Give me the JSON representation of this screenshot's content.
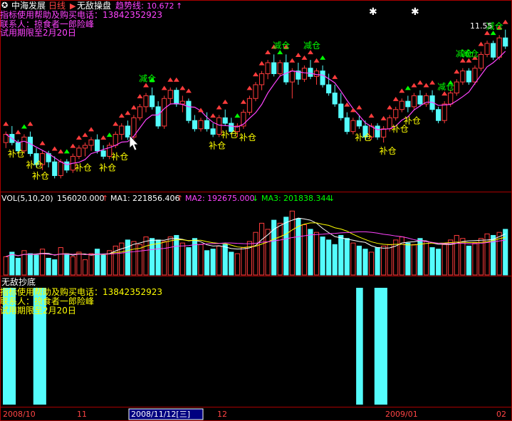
{
  "header": {
    "stock_name": "中海发展",
    "period": "日线",
    "indicator_name": "无敌操盘",
    "trend_label": "趋势线:",
    "trend_value": "10.672",
    "trend_arrow": "↑",
    "help_line": "指标使用帮助及购买电话：13842352923",
    "contact_line": "联系人：掠食者一郎险峰",
    "trial_line": "试用期限至2月20日",
    "price_callout": "11.55"
  },
  "volume_panel": {
    "label": "VOL(5,10,20)",
    "vol_value": "156020.000",
    "vol_arrow": "↑",
    "ma1_label": "MA1:",
    "ma1_value": "221856.406",
    "ma1_arrow": "↑",
    "ma2_label": "MA2:",
    "ma2_value": "192675.000",
    "ma2_arrow": "↓",
    "ma3_label": "MA3:",
    "ma3_value": "201838.344",
    "ma3_arrow": "↓"
  },
  "bottom_panel": {
    "title": "无敌抄底",
    "help_line": "指标使用帮助及购买电话：13842352923",
    "contact_line": "联系人：掠食者一郎险峰",
    "trial_line": "试用期限至2月20日"
  },
  "date_axis": {
    "label_1": "2008/10",
    "label_2": "11",
    "cursor_date": "2008/11/12[三]",
    "label_3": "12",
    "label_4": "2009/01",
    "label_5": "02"
  },
  "signals": {
    "reduce": "减仓",
    "add": "补仓"
  },
  "colors": {
    "up": "#ff3c3c",
    "down": "#54fcfc",
    "ma_trend": "#ff44ff",
    "ma1": "#ffffff",
    "ma2": "#ffff00",
    "ma3": "#ff44ff",
    "signal_green": "#00ff00",
    "signal_yellow": "#ffff00"
  },
  "chart_data": {
    "type": "candlestick",
    "candles": [
      [
        8.9,
        9.3,
        8.7,
        9.2
      ],
      [
        9.2,
        9.5,
        8.8,
        8.9
      ],
      [
        8.9,
        9.0,
        8.5,
        8.6
      ],
      [
        8.6,
        9.2,
        8.5,
        9.1
      ],
      [
        9.1,
        9.3,
        8.4,
        8.5
      ],
      [
        8.5,
        8.7,
        8.0,
        8.1
      ],
      [
        8.1,
        8.6,
        7.9,
        8.5
      ],
      [
        8.5,
        8.6,
        8.0,
        8.2
      ],
      [
        8.2,
        8.4,
        7.6,
        7.7
      ],
      [
        7.7,
        8.3,
        7.6,
        8.2
      ],
      [
        8.2,
        8.3,
        7.8,
        7.9
      ],
      [
        7.9,
        8.5,
        7.8,
        8.4
      ],
      [
        8.4,
        8.8,
        8.3,
        8.7
      ],
      [
        8.7,
        8.9,
        8.4,
        8.8
      ],
      [
        8.8,
        9.1,
        8.6,
        9.0
      ],
      [
        9.0,
        9.2,
        8.5,
        8.6
      ],
      [
        8.6,
        8.8,
        8.3,
        8.4
      ],
      [
        8.4,
        8.9,
        8.3,
        8.8
      ],
      [
        8.8,
        9.3,
        8.7,
        9.2
      ],
      [
        9.2,
        9.6,
        9.0,
        9.5
      ],
      [
        9.5,
        9.7,
        9.0,
        9.1
      ],
      [
        9.1,
        9.9,
        9.0,
        9.8
      ],
      [
        9.8,
        10.3,
        9.7,
        10.2
      ],
      [
        10.2,
        10.7,
        10.0,
        10.6
      ],
      [
        10.6,
        10.9,
        10.1,
        10.2
      ],
      [
        10.2,
        10.4,
        9.4,
        9.5
      ],
      [
        9.5,
        10.6,
        9.4,
        10.5
      ],
      [
        10.5,
        10.9,
        10.3,
        10.8
      ],
      [
        10.8,
        10.9,
        10.2,
        10.3
      ],
      [
        10.3,
        10.6,
        10.0,
        10.4
      ],
      [
        10.4,
        10.5,
        9.6,
        9.7
      ],
      [
        9.7,
        9.9,
        9.3,
        9.4
      ],
      [
        9.4,
        9.8,
        9.3,
        9.7
      ],
      [
        9.7,
        10.0,
        9.3,
        9.4
      ],
      [
        9.4,
        9.6,
        9.1,
        9.2
      ],
      [
        9.2,
        9.9,
        9.1,
        9.8
      ],
      [
        9.8,
        10.1,
        9.5,
        9.6
      ],
      [
        9.6,
        9.8,
        9.2,
        9.3
      ],
      [
        9.3,
        9.6,
        9.1,
        9.5
      ],
      [
        9.5,
        10.1,
        9.4,
        10.0
      ],
      [
        10.0,
        10.6,
        9.9,
        10.5
      ],
      [
        10.5,
        11.1,
        10.4,
        11.0
      ],
      [
        11.0,
        11.5,
        10.8,
        11.4
      ],
      [
        11.4,
        11.9,
        11.2,
        11.8
      ],
      [
        11.8,
        12.1,
        11.3,
        11.4
      ],
      [
        11.4,
        11.9,
        11.3,
        11.8
      ],
      [
        11.8,
        12.1,
        11.0,
        11.1
      ],
      [
        11.1,
        11.6,
        10.5,
        11.5
      ],
      [
        11.5,
        11.8,
        11.0,
        11.2
      ],
      [
        11.2,
        11.7,
        11.1,
        11.6
      ],
      [
        11.6,
        11.9,
        11.2,
        11.3
      ],
      [
        11.3,
        11.6,
        11.0,
        11.5
      ],
      [
        11.5,
        11.7,
        10.9,
        11.0
      ],
      [
        11.0,
        11.4,
        10.6,
        10.7
      ],
      [
        10.7,
        11.0,
        10.2,
        10.3
      ],
      [
        10.3,
        10.7,
        9.7,
        9.8
      ],
      [
        9.8,
        10.0,
        9.2,
        9.3
      ],
      [
        9.3,
        9.8,
        9.2,
        9.7
      ],
      [
        9.7,
        9.9,
        9.4,
        9.5
      ],
      [
        9.5,
        9.7,
        9.0,
        9.1
      ],
      [
        9.1,
        9.6,
        9.0,
        9.5
      ],
      [
        9.5,
        9.6,
        9.0,
        9.1
      ],
      [
        9.1,
        9.5,
        8.9,
        9.4
      ],
      [
        9.4,
        9.9,
        9.3,
        9.8
      ],
      [
        9.8,
        10.2,
        9.7,
        10.1
      ],
      [
        10.1,
        10.5,
        10.0,
        10.4
      ],
      [
        10.4,
        10.6,
        10.0,
        10.2
      ],
      [
        10.2,
        10.7,
        10.1,
        10.6
      ],
      [
        10.6,
        10.8,
        10.2,
        10.3
      ],
      [
        10.3,
        10.7,
        10.2,
        10.6
      ],
      [
        10.6,
        10.8,
        10.0,
        10.1
      ],
      [
        10.1,
        10.2,
        9.6,
        9.7
      ],
      [
        9.7,
        10.4,
        9.6,
        10.3
      ],
      [
        10.3,
        10.8,
        10.2,
        10.7
      ],
      [
        10.7,
        11.2,
        10.6,
        11.1
      ],
      [
        11.1,
        11.6,
        11.0,
        11.5
      ],
      [
        11.5,
        11.6,
        11.0,
        11.1
      ],
      [
        11.1,
        11.7,
        11.0,
        11.6
      ],
      [
        11.6,
        12.2,
        11.5,
        12.1
      ],
      [
        12.1,
        12.6,
        12.0,
        12.5
      ],
      [
        12.5,
        12.6,
        11.9,
        12.0
      ],
      [
        12.0,
        12.8,
        11.9,
        12.7
      ],
      [
        12.7,
        13.0,
        12.3,
        12.4
      ]
    ],
    "volumes": [
      120,
      150,
      110,
      160,
      140,
      130,
      170,
      110,
      100,
      180,
      140,
      120,
      150,
      100,
      140,
      170,
      130,
      160,
      190,
      210,
      230,
      220,
      200,
      250,
      240,
      230,
      220,
      250,
      260,
      210,
      180,
      240,
      200,
      160,
      170,
      190,
      200,
      150,
      140,
      180,
      220,
      280,
      340,
      300,
      360,
      340,
      380,
      420,
      370,
      330,
      300,
      280,
      250,
      230,
      200,
      260,
      240,
      210,
      190,
      170,
      150,
      180,
      190,
      200,
      230,
      250,
      210,
      200,
      240,
      220,
      180,
      170,
      200,
      230,
      260,
      240,
      190,
      210,
      240,
      270,
      260,
      280,
      300
    ],
    "reduce_signal_bars": [
      23,
      45,
      50,
      72,
      75,
      76,
      80
    ],
    "add_signal_bars": [
      1,
      4,
      5,
      12,
      16,
      18,
      34,
      36,
      39,
      58,
      62,
      64,
      66
    ],
    "bottom_signal_bars": [
      0,
      1,
      5,
      6,
      58,
      61,
      62
    ],
    "x_ticks": [
      "2008/10",
      "11",
      "2008/11/12[三]",
      "12",
      "2009/01",
      "02"
    ]
  }
}
